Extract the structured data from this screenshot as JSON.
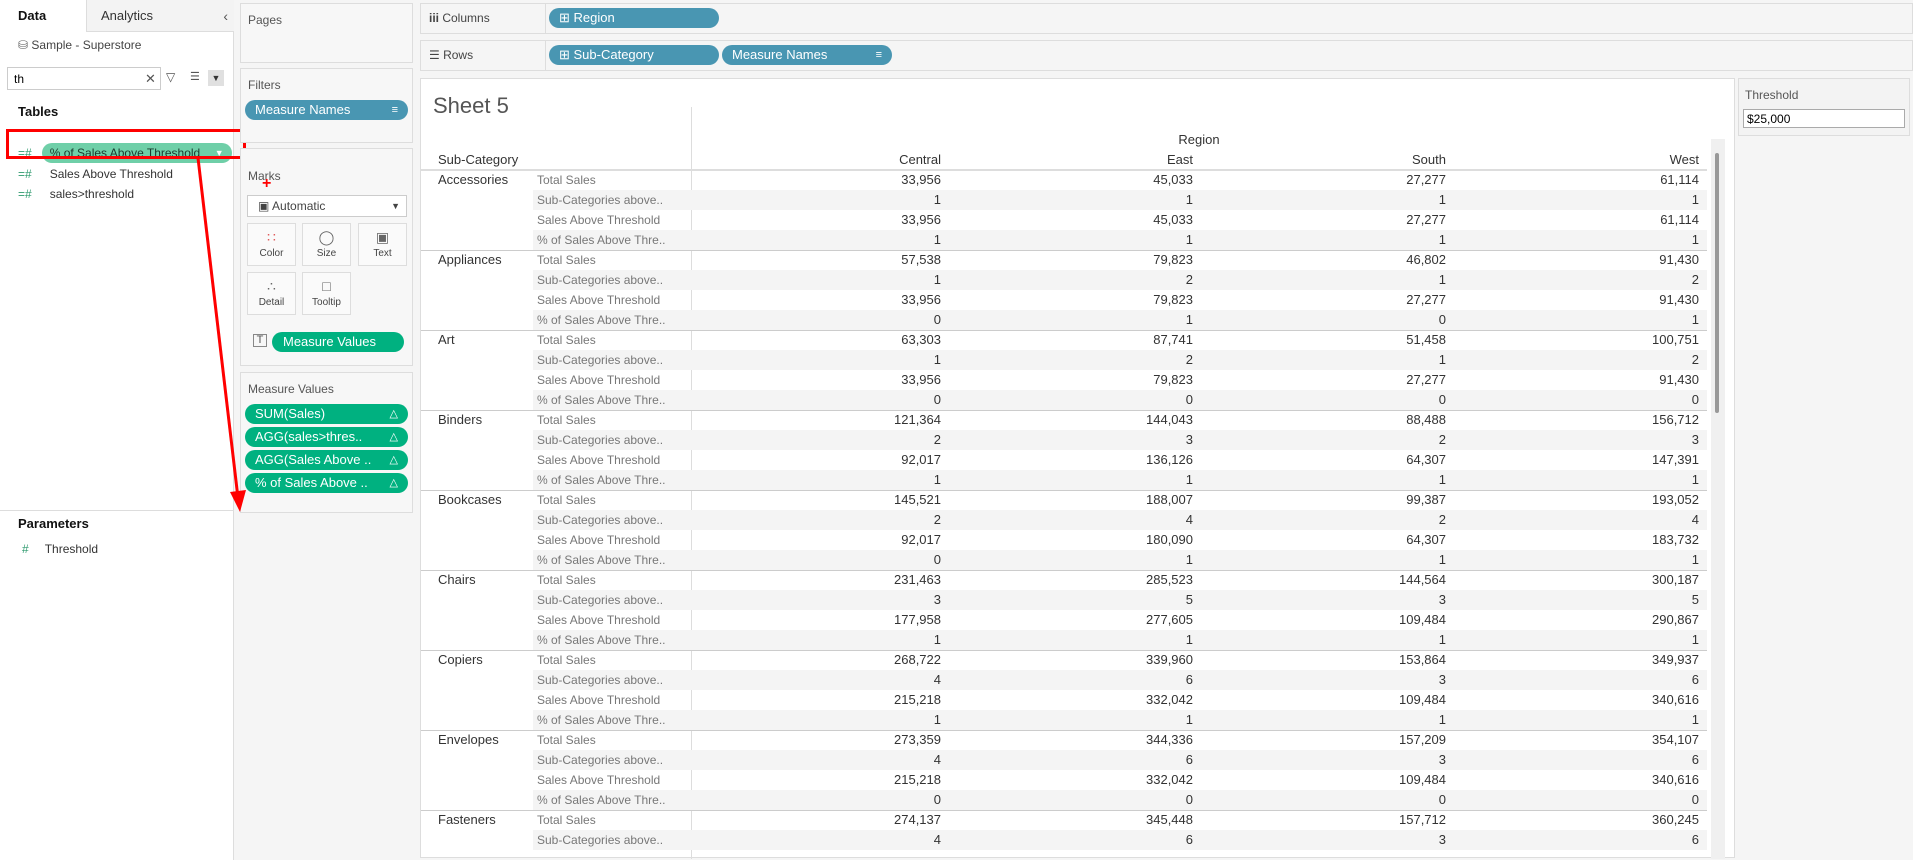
{
  "left": {
    "tabs": [
      "Data",
      "Analytics"
    ],
    "datasource": "Sample - Superstore",
    "search_value": "th",
    "tables_heading": "Tables",
    "fields": [
      "% of Sales Above Threshold",
      "Sales Above Threshold",
      "sales>threshold"
    ],
    "parameters_heading": "Parameters",
    "parameters": [
      "Threshold"
    ]
  },
  "cards": {
    "pages": "Pages",
    "filters": "Filters",
    "filter_pills": [
      "Measure Names"
    ],
    "marks": "Marks",
    "mark_type": "Automatic",
    "mark_buttons": [
      "Color",
      "Size",
      "Text",
      "Detail",
      "Tooltip"
    ],
    "marks_pill": "Measure Values",
    "measure_values": "Measure Values",
    "mv_pills": [
      "SUM(Sales)",
      "AGG(sales>thres..",
      "AGG(Sales Above ..",
      "% of Sales Above .."
    ]
  },
  "shelves": {
    "columns_label": "Columns",
    "columns": [
      "Region"
    ],
    "rows_label": "Rows",
    "rows": [
      "Sub-Category",
      "Measure Names"
    ]
  },
  "sheet": {
    "title": "Sheet 5",
    "col_group": "Region",
    "row_header": "Sub-Category",
    "columns": [
      "Central",
      "East",
      "South",
      "West"
    ],
    "measures": [
      "Total Sales",
      "Sub-Categories above..",
      "Sales Above Threshold",
      "% of Sales Above Thre.."
    ],
    "groups": [
      {
        "name": "Accessories",
        "rows": [
          [
            "33,956",
            "45,033",
            "27,277",
            "61,114"
          ],
          [
            "1",
            "1",
            "1",
            "1"
          ],
          [
            "33,956",
            "45,033",
            "27,277",
            "61,114"
          ],
          [
            "1",
            "1",
            "1",
            "1"
          ]
        ]
      },
      {
        "name": "Appliances",
        "rows": [
          [
            "57,538",
            "79,823",
            "46,802",
            "91,430"
          ],
          [
            "1",
            "2",
            "1",
            "2"
          ],
          [
            "33,956",
            "79,823",
            "27,277",
            "91,430"
          ],
          [
            "0",
            "1",
            "0",
            "1"
          ]
        ]
      },
      {
        "name": "Art",
        "rows": [
          [
            "63,303",
            "87,741",
            "51,458",
            "100,751"
          ],
          [
            "1",
            "2",
            "1",
            "2"
          ],
          [
            "33,956",
            "79,823",
            "27,277",
            "91,430"
          ],
          [
            "0",
            "0",
            "0",
            "0"
          ]
        ]
      },
      {
        "name": "Binders",
        "rows": [
          [
            "121,364",
            "144,043",
            "88,488",
            "156,712"
          ],
          [
            "2",
            "3",
            "2",
            "3"
          ],
          [
            "92,017",
            "136,126",
            "64,307",
            "147,391"
          ],
          [
            "1",
            "1",
            "1",
            "1"
          ]
        ]
      },
      {
        "name": "Bookcases",
        "rows": [
          [
            "145,521",
            "188,007",
            "99,387",
            "193,052"
          ],
          [
            "2",
            "4",
            "2",
            "4"
          ],
          [
            "92,017",
            "180,090",
            "64,307",
            "183,732"
          ],
          [
            "0",
            "1",
            "1",
            "1"
          ]
        ]
      },
      {
        "name": "Chairs",
        "rows": [
          [
            "231,463",
            "285,523",
            "144,564",
            "300,187"
          ],
          [
            "3",
            "5",
            "3",
            "5"
          ],
          [
            "177,958",
            "277,605",
            "109,484",
            "290,867"
          ],
          [
            "1",
            "1",
            "1",
            "1"
          ]
        ]
      },
      {
        "name": "Copiers",
        "rows": [
          [
            "268,722",
            "339,960",
            "153,864",
            "349,937"
          ],
          [
            "4",
            "6",
            "3",
            "6"
          ],
          [
            "215,218",
            "332,042",
            "109,484",
            "340,616"
          ],
          [
            "1",
            "1",
            "1",
            "1"
          ]
        ]
      },
      {
        "name": "Envelopes",
        "rows": [
          [
            "273,359",
            "344,336",
            "157,209",
            "354,107"
          ],
          [
            "4",
            "6",
            "3",
            "6"
          ],
          [
            "215,218",
            "332,042",
            "109,484",
            "340,616"
          ],
          [
            "0",
            "0",
            "0",
            "0"
          ]
        ]
      },
      {
        "name": "Fasteners",
        "rows": [
          [
            "274,137",
            "345,448",
            "157,712",
            "360,245"
          ],
          [
            "4",
            "6",
            "3",
            "6"
          ]
        ]
      }
    ]
  },
  "parameter_control": {
    "label": "Threshold",
    "value": "$25,000"
  },
  "colors": {
    "blue_pill": "#4996b2",
    "green_pill": "#00b180",
    "highlight": "#ff0000"
  }
}
